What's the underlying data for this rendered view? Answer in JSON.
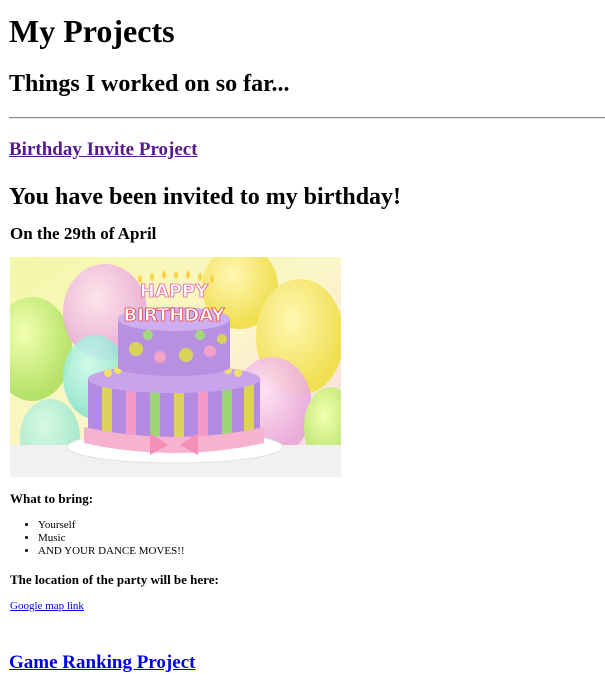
{
  "header": {
    "title": "My Projects",
    "subtitle": "Things I worked on so far..."
  },
  "projects": {
    "birthday_link": "Birthday Invite Project",
    "game_link": "Game Ranking Project"
  },
  "invite": {
    "heading": "You have been invited to my birthday!",
    "date": "On the 29th of April",
    "image": {
      "description_icon": "birthday-cake-image",
      "candle_text_top": "HAPPY",
      "candle_text_bottom": "BIRTHDAY"
    },
    "bring_heading": "What to bring:",
    "bring_items": [
      "Yourself",
      "Music",
      "AND YOUR DANCE MOVES!!"
    ],
    "location_heading": "The location of the party will be here:",
    "map_link": "Google map link"
  },
  "colors": {
    "visited_link": "#551a8b",
    "link": "#0000ee"
  }
}
